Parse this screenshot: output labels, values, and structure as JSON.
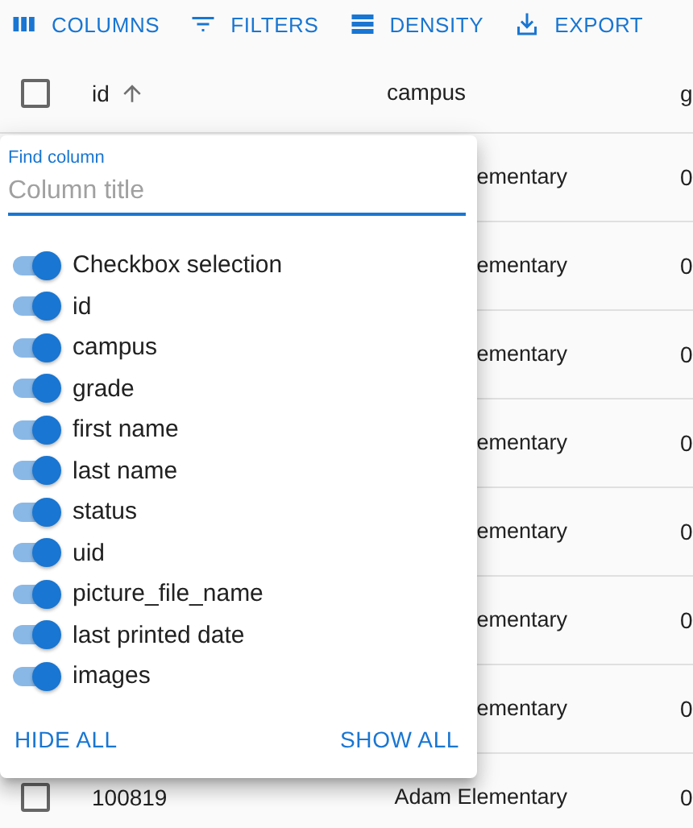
{
  "toolbar": [
    {
      "kind": "columns",
      "label": "COLUMNS"
    },
    {
      "kind": "filters",
      "label": "FILTERS"
    },
    {
      "kind": "density",
      "label": "DENSITY"
    },
    {
      "kind": "export",
      "label": "EXPORT"
    }
  ],
  "table": {
    "select_all": {
      "checked": false
    },
    "columns": [
      {
        "label": "id",
        "sorted": true
      },
      {
        "label": "campus",
        "sorted": false
      },
      {
        "label": "g",
        "sorted": false
      }
    ],
    "rows": [
      {
        "campus": "ementary",
        "column_3": "0"
      },
      {
        "campus": "ementary",
        "column_3": "0"
      },
      {
        "campus": "ementary",
        "column_3": "0"
      },
      {
        "campus": "ementary",
        "column_3": "0"
      },
      {
        "campus": "ementary",
        "column_3": "0"
      },
      {
        "campus": "ementary",
        "column_3": "0"
      },
      {
        "campus": "ementary",
        "column_3": "0"
      },
      {
        "checked": false,
        "id": "100819",
        "campus": "Adam Elementary",
        "column_3": "0"
      }
    ]
  },
  "column_panel": {
    "search": {
      "label": "Find column",
      "placeholder": "Column title"
    },
    "columns": [
      {
        "label": "Checkbox selection",
        "checked": true
      },
      {
        "label": "id",
        "checked": true
      },
      {
        "label": "campus",
        "checked": true
      },
      {
        "label": "grade",
        "checked": true
      },
      {
        "label": "first name",
        "checked": true
      },
      {
        "label": "last name",
        "checked": true
      },
      {
        "label": "status",
        "checked": true
      },
      {
        "label": "uid",
        "checked": true
      },
      {
        "label": "picture_file_name",
        "checked": true
      },
      {
        "label": "last printed date",
        "checked": true
      },
      {
        "label": "images",
        "checked": true
      }
    ],
    "buttons": [
      "HIDE ALL",
      "SHOW ALL"
    ]
  }
}
